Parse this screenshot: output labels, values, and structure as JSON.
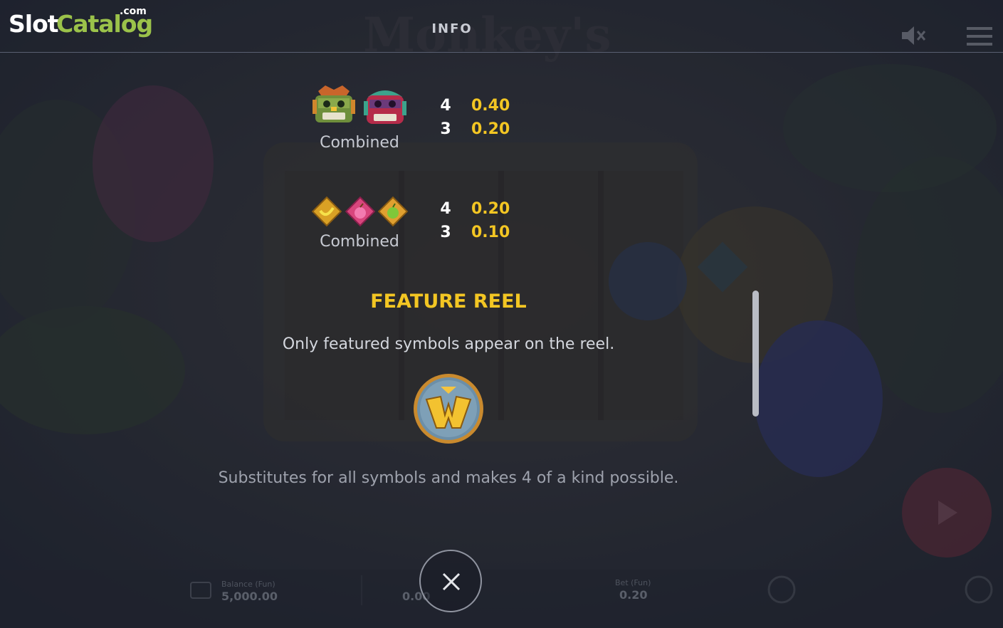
{
  "logo": {
    "slot": "Slot",
    "catalog": "Catalog",
    "com": ".com"
  },
  "header": {
    "title": "INFO"
  },
  "paytable": [
    {
      "symbols": [
        "mask-green-icon",
        "mask-red-icon"
      ],
      "label": "Combined",
      "pays": [
        {
          "count": "4",
          "value": "0.40"
        },
        {
          "count": "3",
          "value": "0.20"
        }
      ]
    },
    {
      "symbols": [
        "banana-icon",
        "peach-icon",
        "lime-icon"
      ],
      "label": "Combined",
      "pays": [
        {
          "count": "4",
          "value": "0.20"
        },
        {
          "count": "3",
          "value": "0.10"
        }
      ]
    }
  ],
  "feature": {
    "title": "FEATURE REEL",
    "description": "Only featured symbols appear on the reel.",
    "wild_description": "Substitutes for all symbols and makes 4 of a kind possible."
  },
  "bottom_bar": {
    "balance_label": "Balance (Fun)",
    "balance_value": "5,000.00",
    "win_value": "0.00",
    "bet_label": "Bet (Fun)",
    "bet_value": "0.20"
  },
  "colors": {
    "accent": "#f3c623",
    "background": "#242a36"
  }
}
